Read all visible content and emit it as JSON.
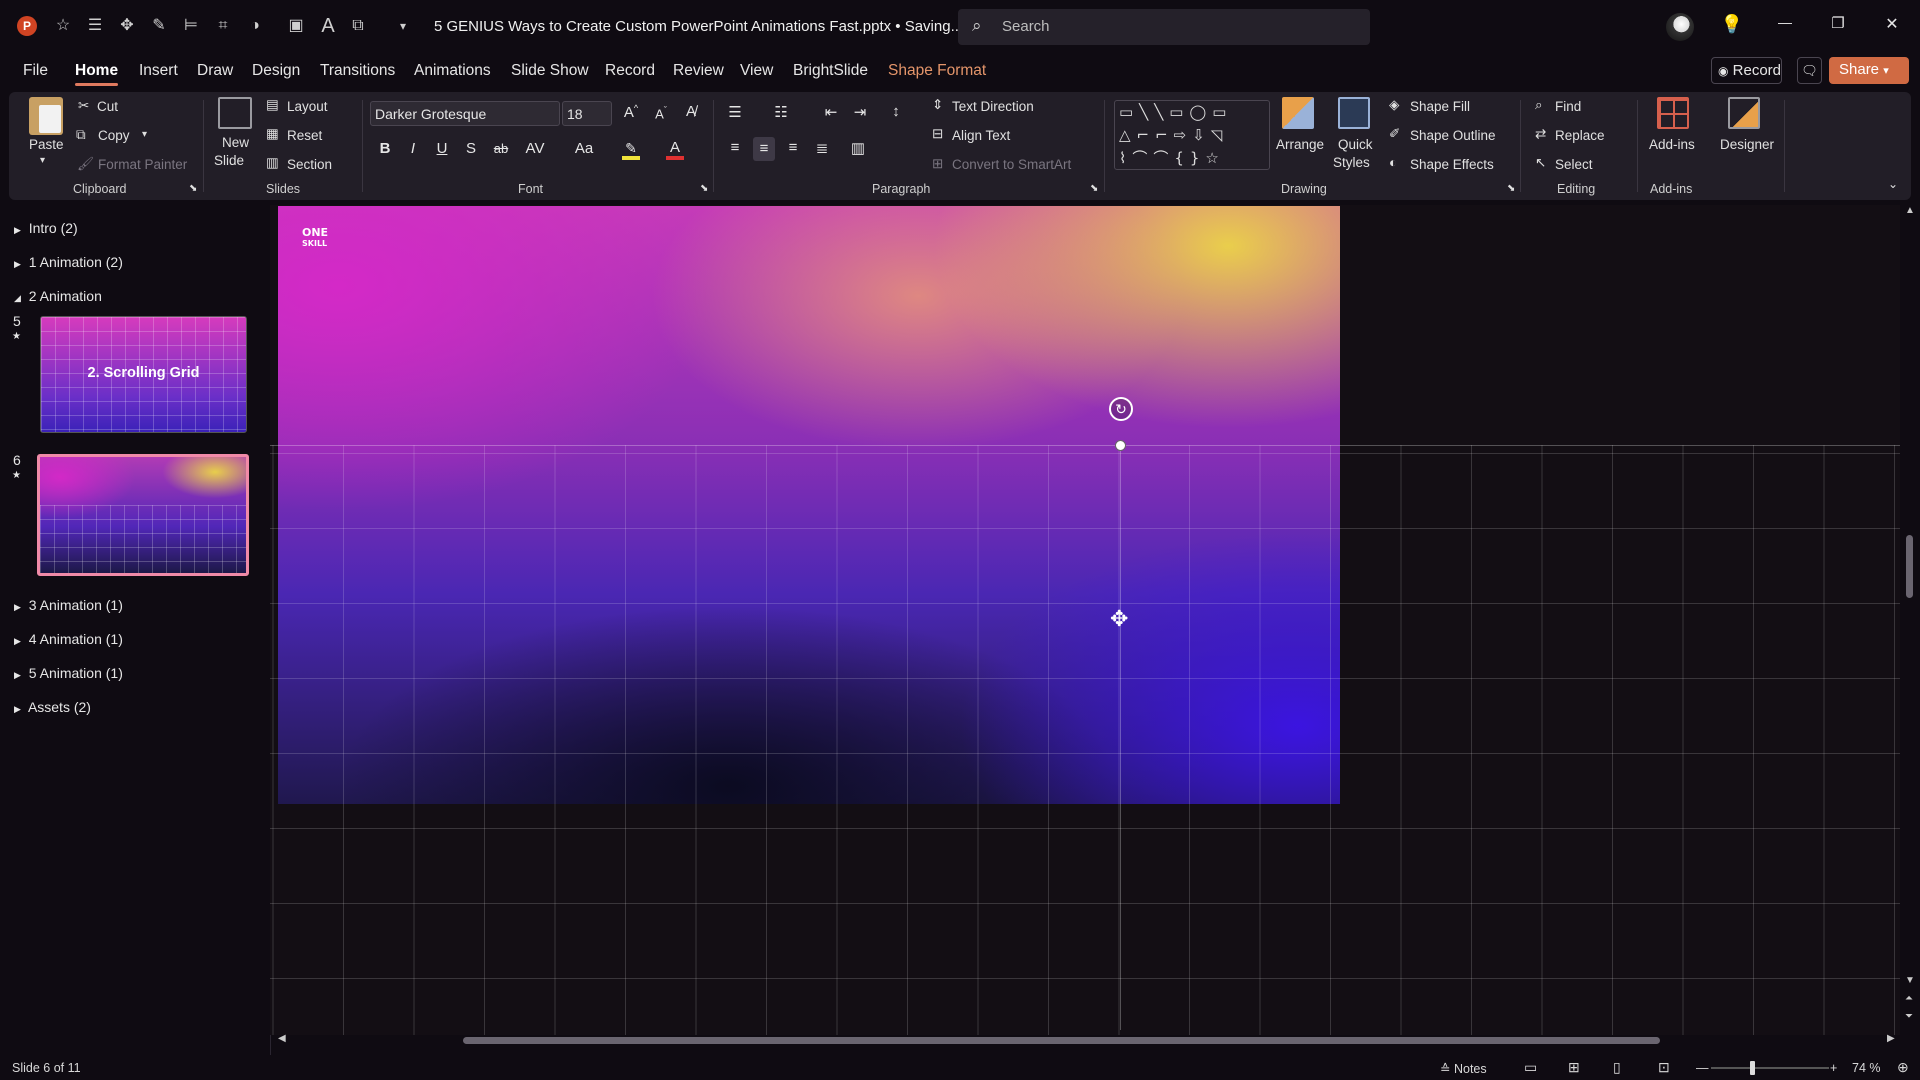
{
  "title_bar": {
    "doc_title": "5 GENIUS Ways to Create Custom PowerPoint Animations Fast.pptx • Saving...",
    "search_placeholder": "Search",
    "minimize": "—",
    "restore": "❐",
    "close": "✕"
  },
  "tabs": [
    "File",
    "Home",
    "Insert",
    "Draw",
    "Design",
    "Transitions",
    "Animations",
    "Slide Show",
    "Record",
    "Review",
    "View",
    "BrightSlide",
    "Shape Format"
  ],
  "active_tab": "Home",
  "header_buttons": {
    "record": "Record",
    "share": "Share"
  },
  "ribbon": {
    "clipboard": {
      "paste": "Paste",
      "cut": "Cut",
      "copy": "Copy",
      "format_painter": "Format Painter",
      "group": "Clipboard"
    },
    "slides": {
      "new_slide_line1": "New",
      "new_slide_line2": "Slide",
      "layout": "Layout",
      "reset": "Reset",
      "section": "Section",
      "group": "Slides"
    },
    "font": {
      "font_name": "Darker Grotesque",
      "font_size": "18",
      "bold": "B",
      "italic": "I",
      "underline": "U",
      "shadow": "S",
      "strike": "ab",
      "spacing": "AV",
      "case": "Aa",
      "group": "Font"
    },
    "paragraph": {
      "text_direction": "Text Direction",
      "align_text": "Align Text",
      "convert_smartart": "Convert to SmartArt",
      "group": "Paragraph"
    },
    "drawing": {
      "arrange": "Arrange",
      "quick_styles_line1": "Quick",
      "quick_styles_line2": "Styles",
      "shape_fill": "Shape Fill",
      "shape_outline": "Shape Outline",
      "shape_effects": "Shape Effects",
      "group": "Drawing"
    },
    "editing": {
      "find": "Find",
      "replace": "Replace",
      "select": "Select",
      "group": "Editing"
    },
    "addins": {
      "addins": "Add-ins",
      "designer": "Designer",
      "group": "Add-ins"
    }
  },
  "slide_panel": {
    "sections": [
      {
        "label": "Intro (2)",
        "expanded": false
      },
      {
        "label": "1 Animation (2)",
        "expanded": false
      },
      {
        "label": "2 Animation",
        "expanded": true
      },
      {
        "label": "3 Animation (1)",
        "expanded": false
      },
      {
        "label": "4 Animation (1)",
        "expanded": false
      },
      {
        "label": "5 Animation (1)",
        "expanded": false
      },
      {
        "label": "Assets (2)",
        "expanded": false
      }
    ],
    "thumbnails": [
      {
        "number": "5",
        "title": "2. Scrolling Grid",
        "selected": false
      },
      {
        "number": "6",
        "title": "",
        "selected": true
      }
    ]
  },
  "slide": {
    "logo_line1": "ONE",
    "logo_line2": "SKILL"
  },
  "status_bar": {
    "slide_indicator": "Slide 6 of 11",
    "notes": "Notes",
    "zoom": "74 %",
    "zoom_minus": "—",
    "zoom_plus": "+"
  },
  "colors": {
    "accent": "#e07a5f",
    "share": "#d06a43",
    "shape_format_tab": "#e4956a",
    "selection_outline": "#f08aa8"
  }
}
